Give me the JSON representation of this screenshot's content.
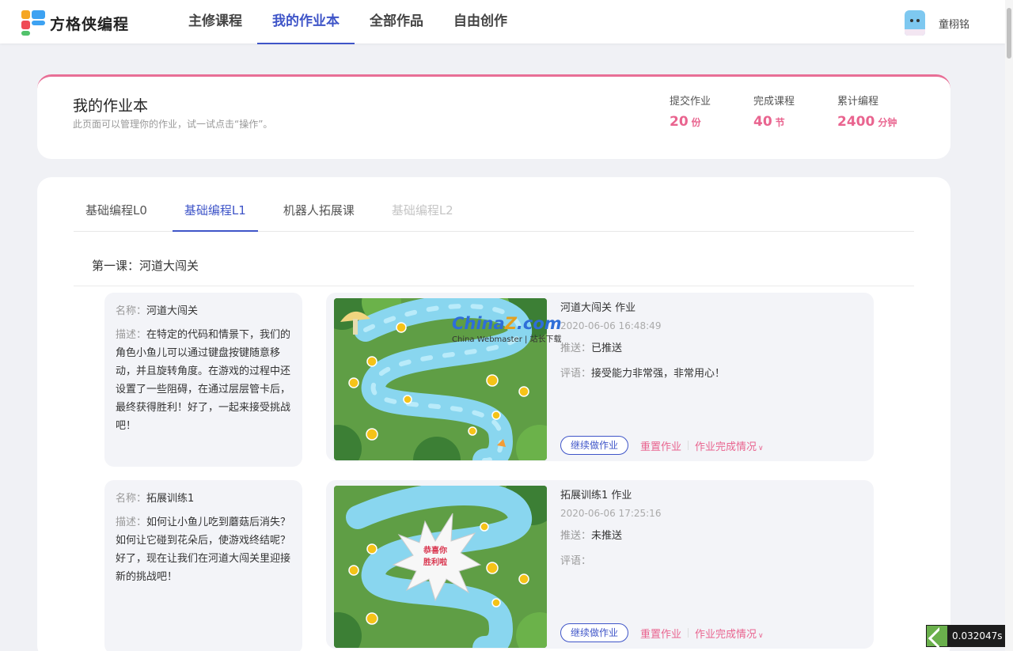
{
  "brand": {
    "name": "方格侠编程"
  },
  "nav": [
    {
      "label": "主修课程",
      "active": false
    },
    {
      "label": "我的作业本",
      "active": true
    },
    {
      "label": "全部作品",
      "active": false
    },
    {
      "label": "自由创作",
      "active": false
    }
  ],
  "user": {
    "name": "童栩铭"
  },
  "header": {
    "title": "我的作业本",
    "subtitle": "此页面可以管理你的作业，试一试点击“操作”。",
    "stats": [
      {
        "label": "提交作业",
        "value": "20",
        "unit": "份"
      },
      {
        "label": "完成课程",
        "value": "40",
        "unit": "节"
      },
      {
        "label": "累计编程",
        "value": "2400",
        "unit": "分钟"
      }
    ]
  },
  "tabs": [
    {
      "label": "基础编程L0",
      "state": "normal"
    },
    {
      "label": "基础编程L1",
      "state": "active"
    },
    {
      "label": "机器人拓展课",
      "state": "normal"
    },
    {
      "label": "基础编程L2",
      "state": "disabled"
    }
  ],
  "lesson": {
    "title": "第一课：河道大闯关"
  },
  "labels": {
    "name": "名称：",
    "desc": "描述：",
    "push": "推送：",
    "comment": "评语：",
    "continue": "继续做作业",
    "reset": "重置作业",
    "status": "作业完成情况"
  },
  "homeworks": [
    {
      "name": "河道大闯关",
      "desc": "在特定的代码和情景下，我们的角色小鱼儿可以通过键盘按键随意移动，并且旋转角度。在游戏的过程中还设置了一些阻碍，在通过层层管卡后，最终获得胜利！好了，一起来接受挑战吧！",
      "work_name": "河道大闯关 作业",
      "time": "2020-06-06 16:48:49",
      "push": "已推送",
      "comment": "接受能力非常强，非常用心！"
    },
    {
      "name": "拓展训练1",
      "desc": "如何让小鱼儿吃到蘑菇后消失？如何让它碰到花朵后，使游戏终结呢？好了，现在让我们在河道大闯关里迎接新的挑战吧！",
      "work_name": "拓展训练1 作业",
      "time": "2020-06-06 17:25:16",
      "push": "未推送",
      "comment": "",
      "badge_line1": "恭喜你",
      "badge_line2": "胜利啦"
    }
  ],
  "watermark": {
    "brand_a": "China",
    "brand_z": "Z",
    "brand_b": ".com",
    "tagline": "China Webmaster | 站长下载"
  },
  "perf": {
    "value": "0.032047s"
  },
  "colors": {
    "accent": "#3f55c8",
    "pink": "#e9648f"
  }
}
